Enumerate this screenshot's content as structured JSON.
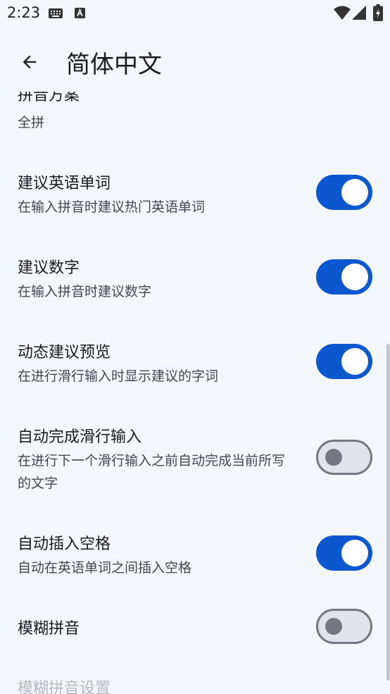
{
  "status_bar": {
    "time": "2:23"
  },
  "app_bar": {
    "title": "简体中文"
  },
  "partial_item": {
    "title": "拼音方案",
    "summary": "全拼"
  },
  "prefs": [
    {
      "title": "建议英语单词",
      "summary": "在输入拼音时建议热门英语单词",
      "checked": true
    },
    {
      "title": "建议数字",
      "summary": "在输入拼音时建议数字",
      "checked": true
    },
    {
      "title": "动态建议预览",
      "summary": "在进行滑行输入时显示建议的字词",
      "checked": true
    },
    {
      "title": "自动完成滑行输入",
      "summary": "在进行下一个滑行输入之前自动完成当前所写的文字",
      "checked": false
    },
    {
      "title": "自动插入空格",
      "summary": "自动在英语单词之间插入空格",
      "checked": true
    },
    {
      "title": "模糊拼音",
      "summary": "",
      "checked": false
    }
  ],
  "disabled_item": {
    "title": "模糊拼音设置"
  },
  "colors": {
    "accent": "#0b57d0",
    "background": "#f3f6fb",
    "switch_off_track": "#e1e3ea",
    "switch_off_thumb": "#74777f"
  }
}
